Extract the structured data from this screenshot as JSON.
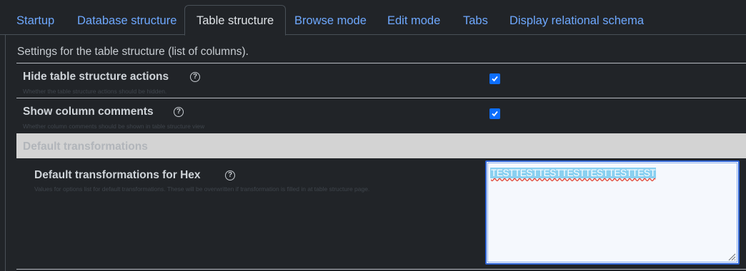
{
  "tabs": [
    {
      "label": "Startup",
      "active": false
    },
    {
      "label": "Database structure",
      "active": false
    },
    {
      "label": "Table structure",
      "active": true
    },
    {
      "label": "Browse mode",
      "active": false
    },
    {
      "label": "Edit mode",
      "active": false
    },
    {
      "label": "Tabs",
      "active": false
    },
    {
      "label": "Display relational schema",
      "active": false
    }
  ],
  "panel": {
    "description": "Settings for the table structure (list of columns).",
    "settings": [
      {
        "title": "Hide table structure actions",
        "subtitle": "Whether the table structure actions should be hidden.",
        "checked": true
      },
      {
        "title": "Show column comments",
        "subtitle": "Whether column comments should be shown in table structure view",
        "checked": true
      }
    ],
    "section": {
      "title": "Default transformations",
      "field": {
        "title": "Default transformations for Hex",
        "subtitle": "Values for options list for default transformations. These will be overwritten if transformation is filled in at table structure page.",
        "value": "TESTTESTTESTTESTTESTTESTTEST"
      }
    },
    "help_icon": "?"
  },
  "colors": {
    "accent": "#0d6efd",
    "link": "#6ea8fe",
    "background": "#212428",
    "section_bg": "#d3d3d3"
  }
}
